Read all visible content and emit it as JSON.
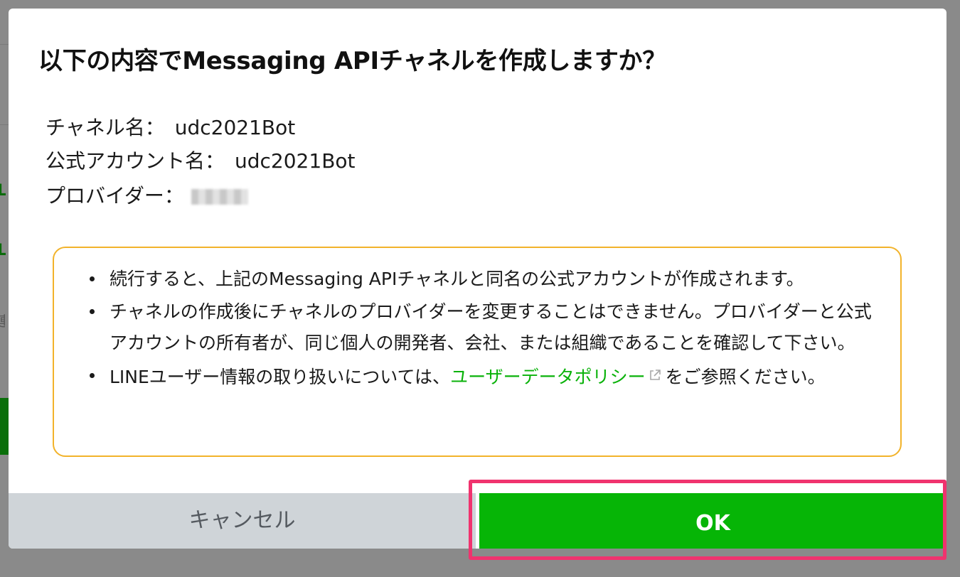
{
  "dialog": {
    "title": "以下の内容でMessaging APIチャネルを作成しますか？",
    "fields": [
      {
        "label": "チャネル名：",
        "value": "udc2021Bot"
      },
      {
        "label": "公式アカウント名：",
        "value": "udc2021Bot"
      },
      {
        "label": "プロバイダー：",
        "value": ""
      }
    ],
    "notice": {
      "item1": "続行すると、上記のMessaging APIチャネルと同名の公式アカウントが作成されます。",
      "item2": "チャネルの作成後にチャネルのプロバイダーを変更することはできません。プロバイダーと公式アカウントの所有者が、同じ個人の開発者、会社、または組織であることを確認して下さい。",
      "item3_prefix": "LINEユーザー情報の取り扱いについては、",
      "item3_link": "ユーザーデータポリシー",
      "item3_suffix": "をご参照ください。"
    },
    "cancel_label": "キャンセル",
    "ok_label": "OK"
  },
  "colors": {
    "accent_green": "#06b506",
    "link_green": "#0ab20a",
    "notice_border": "#f2b32b",
    "highlight": "#f0336e"
  },
  "icons": {
    "external_link": "external-link-icon"
  }
}
